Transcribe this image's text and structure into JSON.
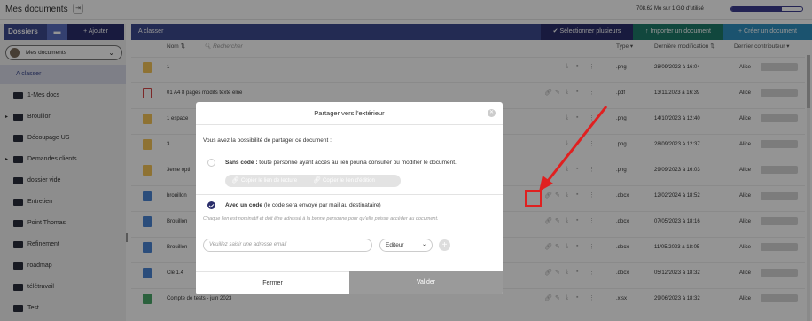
{
  "topbar": {
    "title": "Mes documents",
    "title_icon": "exit-icon",
    "usage_text": "708.62 Mo sur 1 GO d'utilisé",
    "usage_fraction": 0.71
  },
  "sidebar": {
    "title": "Dossiers",
    "add_label": "+ Ajouter",
    "select_value": "Mes documents",
    "items": [
      {
        "label": "A classer",
        "active": true,
        "expandable": false
      },
      {
        "label": "1-Mes docs",
        "expandable": false
      },
      {
        "label": "Brouillon",
        "expandable": true
      },
      {
        "label": "Découpage US",
        "expandable": false
      },
      {
        "label": "Demandes clients",
        "expandable": true
      },
      {
        "label": "dossier vide",
        "expandable": false
      },
      {
        "label": "Entretien",
        "expandable": false
      },
      {
        "label": "Point Thomas",
        "expandable": false
      },
      {
        "label": "Refinement",
        "expandable": false
      },
      {
        "label": "roadmap",
        "expandable": false
      },
      {
        "label": "télétravail",
        "expandable": false
      },
      {
        "label": "Test",
        "expandable": false
      }
    ]
  },
  "main": {
    "folder_title": "A classer",
    "btn_select": "Sélectionner plusieurs",
    "btn_import": "Importer un document",
    "btn_create": "+ Créer un document",
    "columns": {
      "name": "Nom",
      "search_placeholder": "Rechercher",
      "type": "Type",
      "modified": "Dernière modification",
      "contributor": "Dernier contributeur"
    },
    "rows": [
      {
        "name": "1",
        "type": ".png",
        "date": "28/09/2023 à 16:04",
        "owner": "Alice",
        "kind": "png",
        "shared": false
      },
      {
        "name": "01 A4 8 pages modifs texte elne",
        "type": ".pdf",
        "date": "13/11/2023 à 16:39",
        "owner": "Alice",
        "kind": "pdf",
        "shared": true
      },
      {
        "name": "1 espace",
        "type": ".png",
        "date": "14/10/2023 à 12:40",
        "owner": "Alice",
        "kind": "png",
        "shared": false
      },
      {
        "name": "3",
        "type": ".png",
        "date": "28/09/2023 à 12:37",
        "owner": "Alice",
        "kind": "png",
        "shared": false
      },
      {
        "name": "3eme opti",
        "type": ".png",
        "date": "29/09/2023 à 16:03",
        "owner": "Alice",
        "kind": "png",
        "shared": false
      },
      {
        "name": "brouillon",
        "type": ".docx",
        "date": "12/02/2024 à 18:52",
        "owner": "Alice",
        "kind": "docx",
        "shared": true
      },
      {
        "name": "Brouillon",
        "type": ".docx",
        "date": "07/05/2023 à 18:16",
        "owner": "Alice",
        "kind": "docx",
        "shared": true
      },
      {
        "name": "Brouillon",
        "type": ".docx",
        "date": "11/05/2023 à 18:05",
        "owner": "Alice",
        "kind": "docx",
        "shared": true
      },
      {
        "name": "Cle 1.4",
        "type": ".docx",
        "date": "05/12/2023 à 18:32",
        "owner": "Alice",
        "kind": "docx",
        "shared": true
      },
      {
        "name": "Compte de tests - juin 2023",
        "type": ".xlsx",
        "date": "29/06/2023 à 18:32",
        "owner": "Alice",
        "kind": "xlsx",
        "shared": true
      }
    ]
  },
  "modal": {
    "title": "Partager vers l'extérieur",
    "intro": "Vous avez la possibilité de partager ce document :",
    "opt1_bold": "Sans code :",
    "opt1_text": " toute personne ayant accès au lien pourra consulter ou modifier le document.",
    "btn_read": "Copier le lien de lecture",
    "btn_edit": "Copier le lien d'édition",
    "opt2_bold": "Avec un code",
    "opt2_text": " (le code sera envoyé par mail au destinataire)",
    "hint": "Chaque lien est nominatif et doit être adressé à la bonne personne pour qu'elle puisse accéder au document.",
    "email_placeholder": "Veuillez saisir une adresse email",
    "role_value": "Editeur",
    "btn_close": "Fermer",
    "btn_validate": "Valider"
  },
  "colors": {
    "primary": "#3d4a8f",
    "dark": "#2a2e6b",
    "import": "#1e7a6a",
    "create": "#2f8fbf",
    "annotation": "#e02020"
  }
}
